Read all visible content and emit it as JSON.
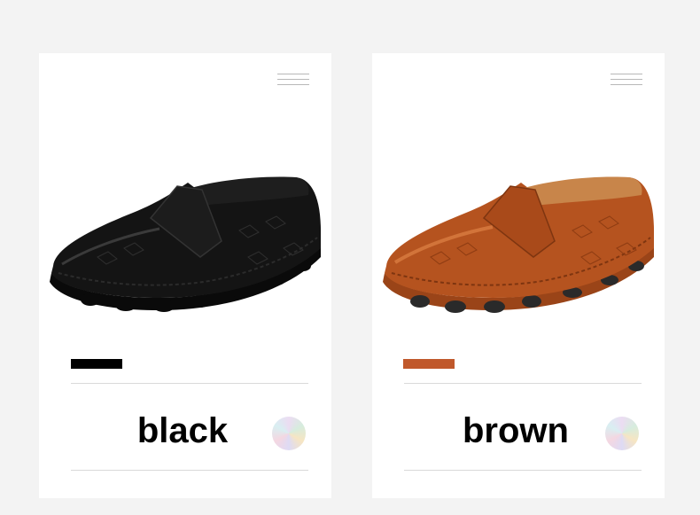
{
  "products": [
    {
      "color_name": "black",
      "swatch_color": "#000000",
      "shoe_colors": {
        "upper": "#141414",
        "upper_light": "#2b2b2b",
        "sole": "#0a0a0a",
        "lining": "#1e1e1e"
      }
    },
    {
      "color_name": "brown",
      "swatch_color": "#c0582b",
      "shoe_colors": {
        "upper": "#b5531f",
        "upper_light": "#d2743a",
        "sole": "#2a2a2a",
        "lining": "#c8854a"
      }
    }
  ],
  "colors": {
    "page_background": "#f3f3f3",
    "card_background": "#ffffff",
    "divider": "#d9d9d9"
  }
}
